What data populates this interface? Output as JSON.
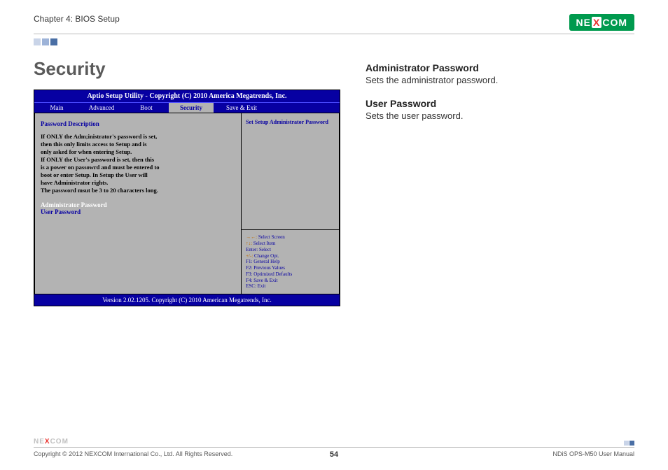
{
  "header": {
    "chapter": "Chapter 4: BIOS Setup",
    "logo_left": "NE",
    "logo_mid": "X",
    "logo_right": "COM"
  },
  "page_title": "Security",
  "bios": {
    "titlebar": "Aptio Setup Utility - Copyright (C) 2010 America Megatrends, Inc.",
    "tabs": {
      "main": "Main",
      "advanced": "Advanced",
      "boot": "Boot",
      "security": "Security",
      "saveexit": "Save & Exit"
    },
    "main_panel": {
      "heading": "Password Description",
      "desc_l1": "If ONLY the Adm;inistrator's password is set,",
      "desc_l2": "then this only limits access to Setup and is",
      "desc_l3": "only asked for when entering Setup.",
      "desc_l4": "If ONLY the User's password is set, then this",
      "desc_l5": "is a power on passowrd and must be entered to",
      "desc_l6": "boot or enter Setup. In Setup the User will",
      "desc_l7": "have Administrator rights.",
      "desc_l8": "The password msut be 3 to 20 characters long.",
      "item_admin": "Administrator Password",
      "item_user": "User Password"
    },
    "help_text": "Set Setup Administrator Password",
    "keys": {
      "k1a": "→←: ",
      "k1b": "Select Screen",
      "k2a": "↑↓: ",
      "k2b": "Select Item",
      "k3a": "Enter: ",
      "k3b": "Select",
      "k4a": "+/-: ",
      "k4b": "Change Opt.",
      "k5a": "F1: ",
      "k5b": "General Help",
      "k6a": "F2: ",
      "k6b": "Previous Values",
      "k7a": "F3: ",
      "k7b": "Optimized Defaults",
      "k8a": "F4: ",
      "k8b": "Save & Exit",
      "k9a": "ESC: ",
      "k9b": "Exit"
    },
    "footer": "Version 2.02.1205. Copyright (C) 2010 American Megatrends, Inc."
  },
  "right": {
    "h1": "Administrator Password",
    "p1": "Sets the administrator password.",
    "h2": "User Password",
    "p2": "Sets the user password."
  },
  "footer": {
    "logo_left": "NE",
    "logo_mid": "X",
    "logo_right": "COM",
    "copyright": "Copyright © 2012 NEXCOM International Co., Ltd. All Rights Reserved.",
    "pagenum": "54",
    "manual": "NDiS OPS-M50 User Manual"
  }
}
